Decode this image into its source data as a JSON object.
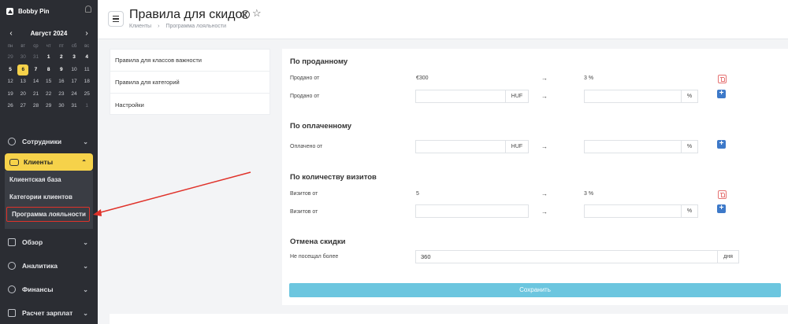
{
  "sidebar": {
    "brand": "Bobby Pin",
    "calendar": {
      "prev": "‹",
      "next": "›",
      "month": "Август 2024",
      "weekdays": [
        "пн",
        "вт",
        "ср",
        "чт",
        "пт",
        "сб",
        "вс"
      ],
      "days": [
        {
          "d": "29",
          "s": "muted"
        },
        {
          "d": "30",
          "s": "muted"
        },
        {
          "d": "31",
          "s": "muted"
        },
        {
          "d": "1",
          "s": "bold"
        },
        {
          "d": "2",
          "s": "bold"
        },
        {
          "d": "3",
          "s": "bold"
        },
        {
          "d": "4",
          "s": "bold"
        },
        {
          "d": "5",
          "s": "bold"
        },
        {
          "d": "6",
          "s": "today"
        },
        {
          "d": "7",
          "s": "bold"
        },
        {
          "d": "8",
          "s": "bold"
        },
        {
          "d": "9",
          "s": "bold"
        },
        {
          "d": "10",
          "s": ""
        },
        {
          "d": "11",
          "s": ""
        },
        {
          "d": "12",
          "s": ""
        },
        {
          "d": "13",
          "s": ""
        },
        {
          "d": "14",
          "s": ""
        },
        {
          "d": "15",
          "s": ""
        },
        {
          "d": "16",
          "s": ""
        },
        {
          "d": "17",
          "s": ""
        },
        {
          "d": "18",
          "s": ""
        },
        {
          "d": "19",
          "s": ""
        },
        {
          "d": "20",
          "s": ""
        },
        {
          "d": "21",
          "s": ""
        },
        {
          "d": "22",
          "s": ""
        },
        {
          "d": "23",
          "s": ""
        },
        {
          "d": "24",
          "s": ""
        },
        {
          "d": "25",
          "s": ""
        },
        {
          "d": "26",
          "s": ""
        },
        {
          "d": "27",
          "s": ""
        },
        {
          "d": "28",
          "s": ""
        },
        {
          "d": "29",
          "s": ""
        },
        {
          "d": "30",
          "s": ""
        },
        {
          "d": "31",
          "s": ""
        },
        {
          "d": "1",
          "s": "muted"
        }
      ]
    },
    "nav": {
      "staff": "Сотрудники",
      "clients": "Клиенты",
      "sub": [
        "Клиентская база",
        "Категории клиентов",
        "Программа лояльности"
      ],
      "overview": "Обзор",
      "analytics": "Аналитика",
      "finance": "Финансы",
      "payroll": "Расчет зарплат"
    }
  },
  "header": {
    "title": "Правила для скидок",
    "breadcrumb": [
      "Клиенты",
      "›",
      "Программа лояльности"
    ]
  },
  "tabs": [
    "Правила для классов важности",
    "Правила для категорий",
    "Настройки"
  ],
  "main": {
    "sold": {
      "title": "По проданному",
      "row1": {
        "label": "Продано от",
        "value": "€300",
        "arrow": "→",
        "result": "3 %"
      },
      "row2": {
        "label": "Продано от",
        "currency": "HUF",
        "arrow": "→",
        "pct": "%"
      }
    },
    "paid": {
      "title": "По оплаченному",
      "row1": {
        "label": "Оплачено от",
        "currency": "HUF",
        "arrow": "→",
        "pct": "%"
      }
    },
    "visits": {
      "title": "По количеству визитов",
      "row1": {
        "label": "Визитов от",
        "value": "5",
        "arrow": "→",
        "result": "3 %"
      },
      "row2": {
        "label": "Визитов от",
        "arrow": "→",
        "pct": "%"
      }
    },
    "cancel": {
      "title": "Отмена скидки",
      "label": "Не посещал более",
      "value": "360",
      "unit": "дня"
    },
    "save": "Сохранить"
  },
  "colors": {
    "accent": "#f6d24a",
    "sidebar": "#2b2d33",
    "save": "#6cc6df",
    "add": "#3d79c9",
    "delete": "#e57373",
    "annotation": "#e0322a"
  }
}
